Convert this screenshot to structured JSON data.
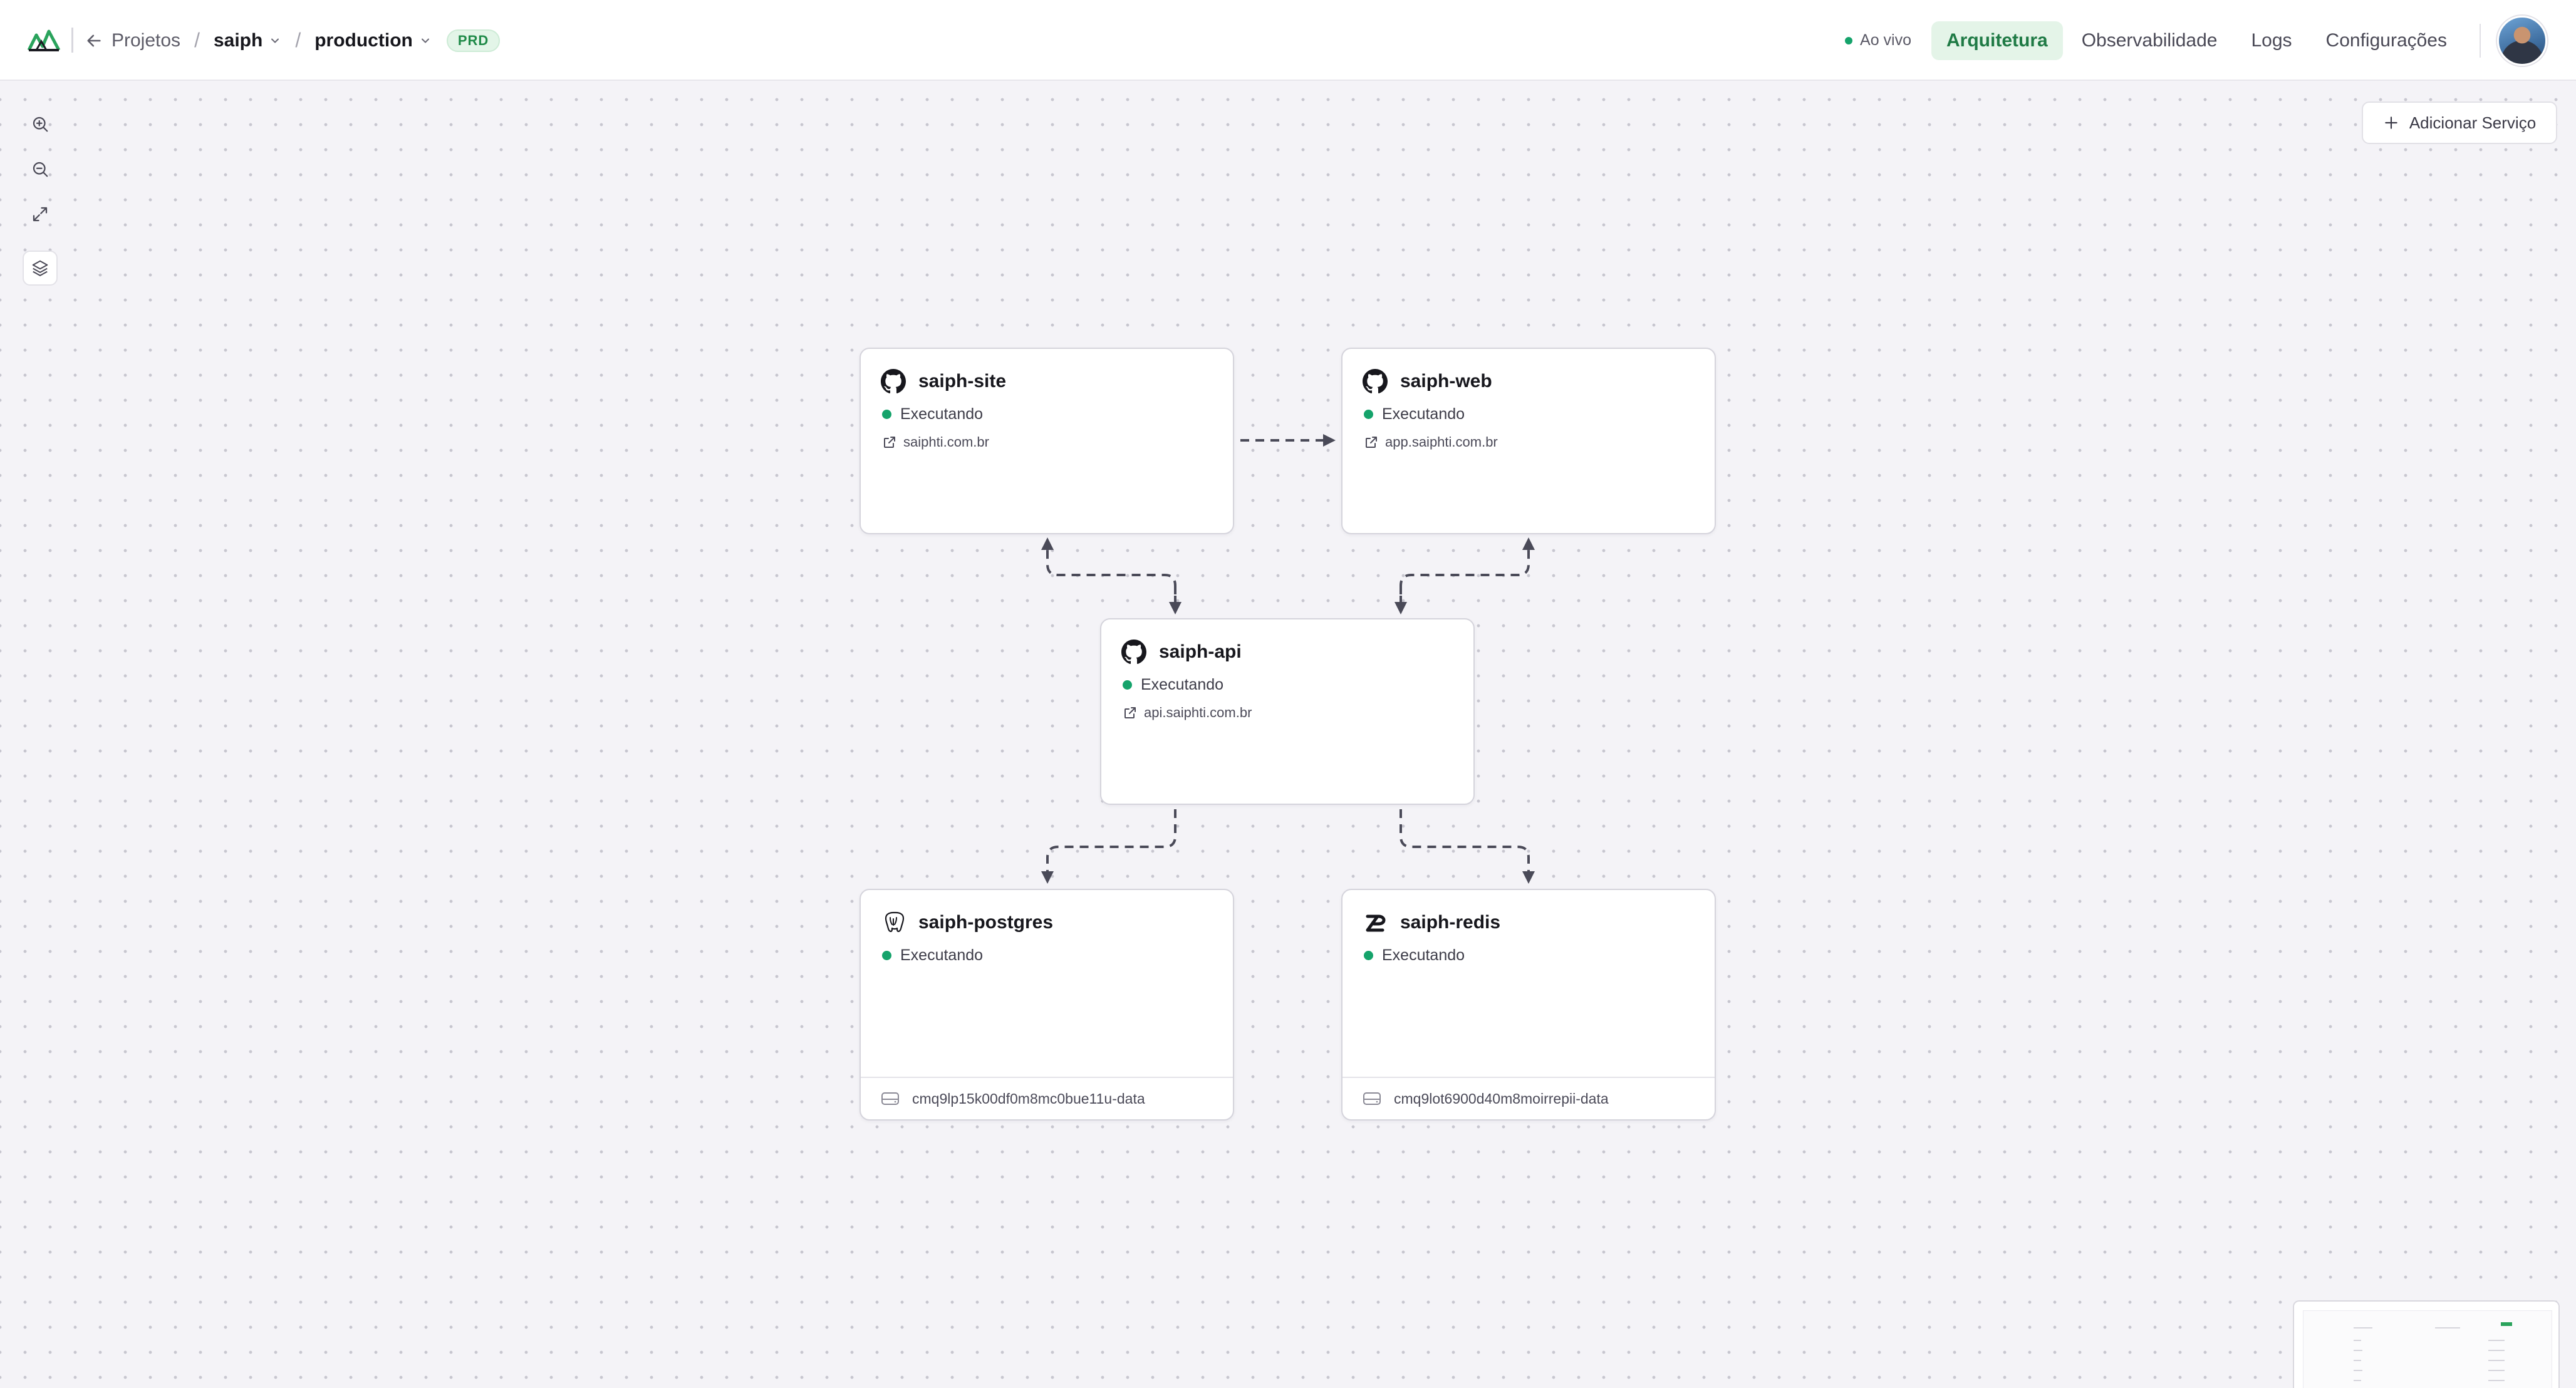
{
  "header": {
    "back_label": "Projetos",
    "project": "saiph",
    "environment": "production",
    "env_badge": "PRD",
    "live_label": "Ao vivo",
    "tabs": [
      {
        "label": "Arquitetura",
        "active": true
      },
      {
        "label": "Observabilidade",
        "active": false
      },
      {
        "label": "Logs",
        "active": false
      },
      {
        "label": "Configurações",
        "active": false
      }
    ]
  },
  "toolbar": {
    "tools": [
      "zoom-in-icon",
      "zoom-out-icon",
      "fit-view-icon",
      "layers-icon"
    ],
    "add_service_label": "Adicionar Serviço"
  },
  "services": [
    {
      "id": "site",
      "name": "saiph-site",
      "icon": "github-icon",
      "status": "Executando",
      "url": "saiphti.com.br"
    },
    {
      "id": "web",
      "name": "saiph-web",
      "icon": "github-icon",
      "status": "Executando",
      "url": "app.saiphti.com.br"
    },
    {
      "id": "api",
      "name": "saiph-api",
      "icon": "github-icon",
      "status": "Executando",
      "url": "api.saiphti.com.br"
    },
    {
      "id": "postgres",
      "name": "saiph-postgres",
      "icon": "postgresql-icon",
      "status": "Executando",
      "volume": "cmq9lp15k00df0m8mc0bue11u-data"
    },
    {
      "id": "redis",
      "name": "saiph-redis",
      "icon": "redis-icon",
      "status": "Executando",
      "volume": "cmq9lot6900d40m8moirrepii-data"
    }
  ],
  "colors": {
    "accent": "#1f7a45",
    "status_running": "#15a36b",
    "badge_bg": "#e3f5e8",
    "edge": "#4a4a58",
    "canvas_bg": "#f4f3f7"
  }
}
